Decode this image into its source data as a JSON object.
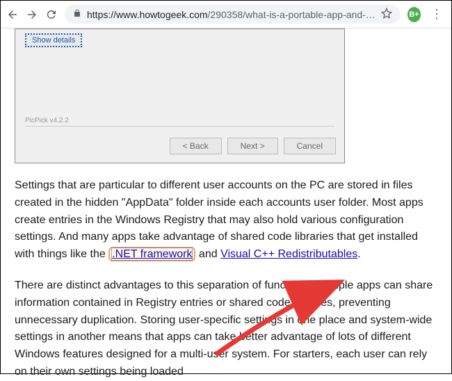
{
  "browser": {
    "url_domain": "https://www.howtogeek.com",
    "url_path": "/290358/what-is-a-portable-app-and-…",
    "profile_letter": "B+"
  },
  "wizard": {
    "show_details": "Show details",
    "version": "PicPick v4.2.2",
    "back": "< Back",
    "next": "Next >",
    "cancel": "Cancel"
  },
  "article": {
    "para1_part1": "Settings that are particular to different user accounts on the PC are stored in files created in the hidden \"AppData\" folder inside each accounts user folder. Most apps create entries in the Windows Registry that may also hold various configuration settings. And many apps take advantage of shared code libraries that get installed with things like the ",
    "link_net": ".NET framework",
    "para1_part2": " and ",
    "link_vcpp": "Visual C++ Redistributables",
    "para1_end": ".",
    "para2": "There are distinct advantages to this separation of functions. Multiple apps can share information contained in Registry entries or shared code libraries, preventing unnecessary duplication. Storing user-specific settings in one place and system-wide settings in another means that apps can take better advantage of lots of different Windows features designed for a multi-user system. For starters, each user can rely on their own settings being loaded"
  }
}
